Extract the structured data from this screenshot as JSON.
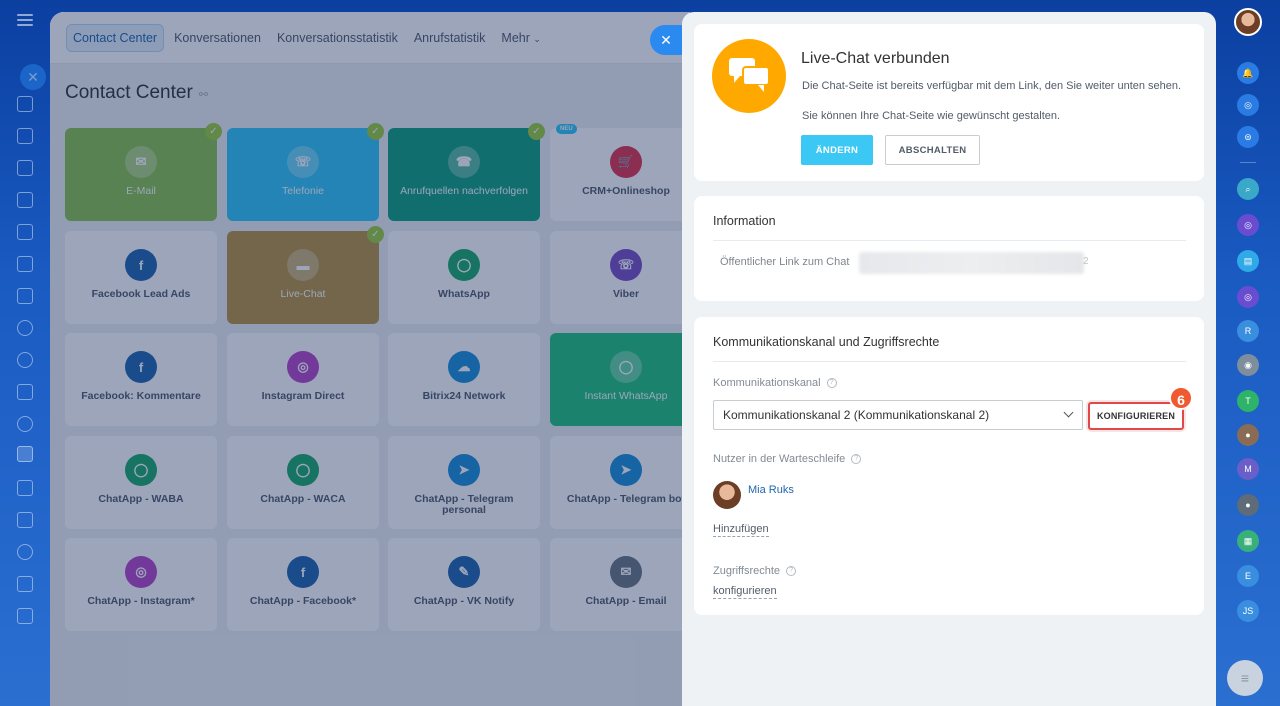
{
  "main": {
    "tabs": [
      {
        "label": "Contact Center",
        "active": true
      },
      {
        "label": "Konversationen"
      },
      {
        "label": "Konversationsstatistik"
      },
      {
        "label": "Anrufstatistik"
      },
      {
        "label": "Mehr"
      }
    ],
    "neu_label": "NEU",
    "title": "Contact Center",
    "tiles": [
      {
        "label": "E-Mail",
        "color": "green",
        "checked": true
      },
      {
        "label": "Telefonie",
        "color": "blue",
        "checked": true
      },
      {
        "label": "Anrufquellen nachverfolgen",
        "color": "teal",
        "checked": true
      },
      {
        "label": "CRM+Onlineshop",
        "color": "white",
        "badge": "NEU"
      },
      {
        "label": "Facebook Lead Ads",
        "color": "white"
      },
      {
        "label": "Live-Chat",
        "color": "brown",
        "checked": true
      },
      {
        "label": "WhatsApp",
        "color": "white"
      },
      {
        "label": "Viber",
        "color": "white"
      },
      {
        "label": "Facebook: Kommentare",
        "color": "white"
      },
      {
        "label": "Instagram Direct",
        "color": "white"
      },
      {
        "label": "Bitrix24 Network",
        "color": "white"
      },
      {
        "label": "Instant WhatsApp",
        "color": "wa"
      },
      {
        "label": "ChatApp - WABA",
        "color": "white"
      },
      {
        "label": "ChatApp - WACA",
        "color": "white"
      },
      {
        "label": "ChatApp - Telegram personal",
        "color": "white"
      },
      {
        "label": "ChatApp - Telegram bot",
        "color": "white"
      },
      {
        "label": "ChatApp - Instagram*",
        "color": "white"
      },
      {
        "label": "ChatApp - Facebook*",
        "color": "white"
      },
      {
        "label": "ChatApp - VK Notify",
        "color": "white"
      },
      {
        "label": "ChatApp - Email",
        "color": "white"
      }
    ]
  },
  "panel": {
    "header": {
      "title": "Live-Chat verbunden",
      "line1": "Die Chat-Seite ist bereits verfügbar mit dem Link, den Sie weiter unten sehen.",
      "line2": "Sie können Ihre Chat-Seite wie gewünscht gestalten.",
      "change_button": "ÄNDERN",
      "disable_button": "ABSCHALTEN"
    },
    "info": {
      "title": "Information",
      "public_link_label": "Öffentlicher Link zum Chat",
      "public_link_tail": "2"
    },
    "channel": {
      "title": "Kommunikationskanal und Zugriffsrechte",
      "channel_label": "Kommunikationskanal",
      "channel_value": "Kommunikationskanal 2 (Kommunikationskanal 2)",
      "configure_button": "KONFIGURIEREN",
      "step_number": "6",
      "queue_label": "Nutzer in der Warteschleife",
      "queue_user": "Mia Ruks",
      "add_link": "Hinzufügen",
      "access_label": "Zugriffsrechte",
      "access_link": "konfigurieren"
    }
  },
  "right_rail": {
    "letters": [
      "R",
      "T",
      "M",
      "E",
      "JS"
    ]
  },
  "colors": {
    "accent": "#3bc8f5",
    "bubble": "#ffa900",
    "highlight": "#e0494a",
    "step": "#f05a30"
  }
}
